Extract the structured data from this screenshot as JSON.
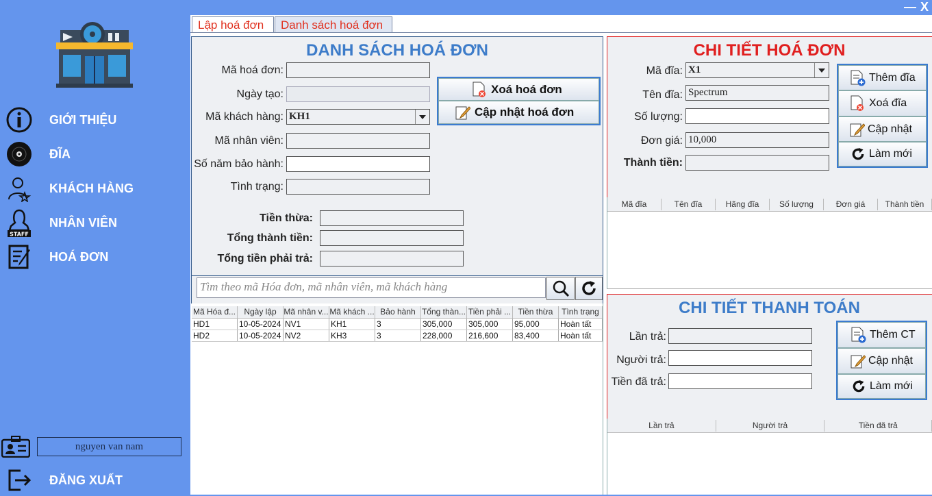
{
  "window": {
    "minimize": "—",
    "close": "X"
  },
  "sidebar": {
    "items": [
      {
        "label": "GIỚI THIỆU",
        "icon": "info-icon"
      },
      {
        "label": "ĐĨA",
        "icon": "disc-icon"
      },
      {
        "label": "KHÁCH HÀNG",
        "icon": "customer-icon"
      },
      {
        "label": "NHÂN VIÊN",
        "icon": "staff-icon"
      },
      {
        "label": "HOÁ ĐƠN",
        "icon": "invoice-icon"
      }
    ],
    "username": "nguyen van nam",
    "logout": "ĐĂNG XUẤT"
  },
  "tabs": [
    {
      "label": "Lập hoá đơn",
      "active": true
    },
    {
      "label": "Danh sách hoá đơn",
      "active": false
    }
  ],
  "invoice_list": {
    "title": "DANH SÁCH HOÁ ĐƠN",
    "labels": {
      "id": "Mã hoá đơn:",
      "date": "Ngày tạo:",
      "customer": "Mã khách hàng:",
      "employee": "Mã nhân viên:",
      "warranty": "Số năm bảo hành:",
      "status": "Tình trạng:",
      "change": "Tiền thừa:",
      "total": "Tổng thành tiền:",
      "payable": "Tổng tiền phải trả:"
    },
    "values": {
      "customer": "KH1"
    },
    "delete_button": "Xoá hoá đơn",
    "update_button": "Cập nhật hoá đơn",
    "search_placeholder": "Tìm theo mã Hóa đơn, mã nhân viên, mã khách hàng",
    "table": {
      "columns": [
        "Mã Hóa đ...",
        "Ngày lập",
        "Mã nhân v...",
        "Mã khách ...",
        "Bảo hành",
        "Tổng thàn...",
        "Tiền phải ...",
        "Tiền thừa",
        "Tình trạng"
      ],
      "rows": [
        [
          "HD1",
          "10-05-2024",
          "NV1",
          "KH1",
          "3",
          "305,000",
          "305,000",
          "95,000",
          "Hoàn tất"
        ],
        [
          "HD2",
          "10-05-2024",
          "NV2",
          "KH3",
          "3",
          "228,000",
          "216,600",
          "83,400",
          "Hoàn tất"
        ]
      ]
    }
  },
  "invoice_detail": {
    "title": "CHI TIẾT HOÁ ĐƠN",
    "labels": {
      "disc_id": "Mã đĩa:",
      "disc_name": "Tên đĩa:",
      "quantity": "Số lượng:",
      "unit_price": "Đơn giá:",
      "amount": "Thành tiền:"
    },
    "values": {
      "disc_id": "X1",
      "disc_name": "Spectrum",
      "unit_price": "10,000"
    },
    "buttons": {
      "add": "Thêm đĩa",
      "delete": "Xoá đĩa",
      "update": "Cập nhật",
      "refresh": "Làm mới"
    },
    "table": {
      "columns": [
        "Mã đĩa",
        "Tên đĩa",
        "Hãng đĩa",
        "Số lượng",
        "Đơn giá",
        "Thành tiền"
      ]
    }
  },
  "payment_detail": {
    "title": "CHI TIẾT THANH TOÁN",
    "labels": {
      "time": "Lần trả:",
      "payer": "Người trả:",
      "paid": "Tiền đã trả:"
    },
    "buttons": {
      "add": "Thêm CT",
      "update": "Cập nhật",
      "refresh": "Làm mới"
    },
    "table": {
      "columns": [
        "Lần trả",
        "Người trả",
        "Tiền đã trả"
      ]
    }
  },
  "colors": {
    "sidebar": "#6495ED",
    "title_blue": "#3d7cc9",
    "title_red": "#e01f1f",
    "tab_text": "#e0301e"
  }
}
